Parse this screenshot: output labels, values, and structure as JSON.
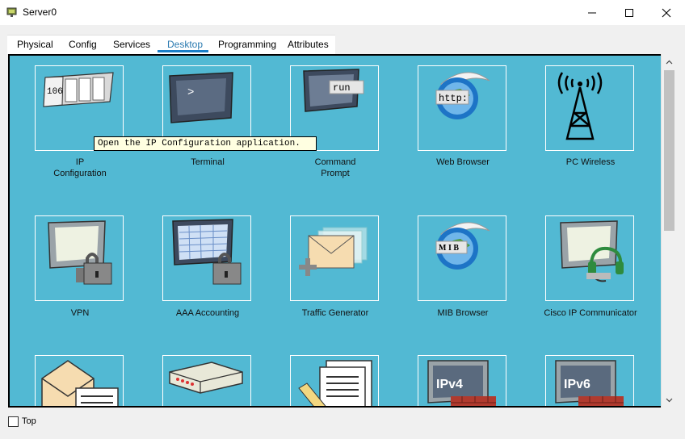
{
  "window": {
    "title": "Server0"
  },
  "tabs": [
    {
      "label": "Physical"
    },
    {
      "label": "Config"
    },
    {
      "label": "Services"
    },
    {
      "label": "Desktop",
      "active": true
    },
    {
      "label": "Programming"
    },
    {
      "label": "Attributes"
    }
  ],
  "desktop": {
    "apps": [
      {
        "line1": "IP",
        "line2": "Configuration",
        "icon": "ip-config-icon"
      },
      {
        "line1": "Terminal",
        "line2": "",
        "icon": "terminal-icon"
      },
      {
        "line1": "Command",
        "line2": "Prompt",
        "icon": "command-prompt-icon"
      },
      {
        "line1": "Web Browser",
        "line2": "",
        "icon": "web-browser-icon"
      },
      {
        "line1": "PC Wireless",
        "line2": "",
        "icon": "pc-wireless-icon"
      },
      {
        "line1": "VPN",
        "line2": "",
        "icon": "vpn-icon"
      },
      {
        "line1": "AAA Accounting",
        "line2": "",
        "icon": "aaa-accounting-icon"
      },
      {
        "line1": "Traffic Generator",
        "line2": "",
        "icon": "traffic-generator-icon"
      },
      {
        "line1": "MIB Browser",
        "line2": "",
        "icon": "mib-browser-icon"
      },
      {
        "line1": "Cisco IP Communicator",
        "line2": "",
        "icon": "cisco-ip-communicator-icon"
      }
    ],
    "icon_text": {
      "ip_number": "106",
      "terminal_prompt": ">",
      "run": "run",
      "http": "http:",
      "mib": "M I B",
      "ipv4": "IPv4",
      "ipv6": "IPv6"
    },
    "tooltip": "Open the IP Configuration application."
  },
  "footer": {
    "top_label": "Top",
    "top_checked": false
  },
  "colors": {
    "desktop_bg": "#52b9d3",
    "active_tab": "#2a7ab0",
    "tooltip_bg": "#ffffe1"
  }
}
